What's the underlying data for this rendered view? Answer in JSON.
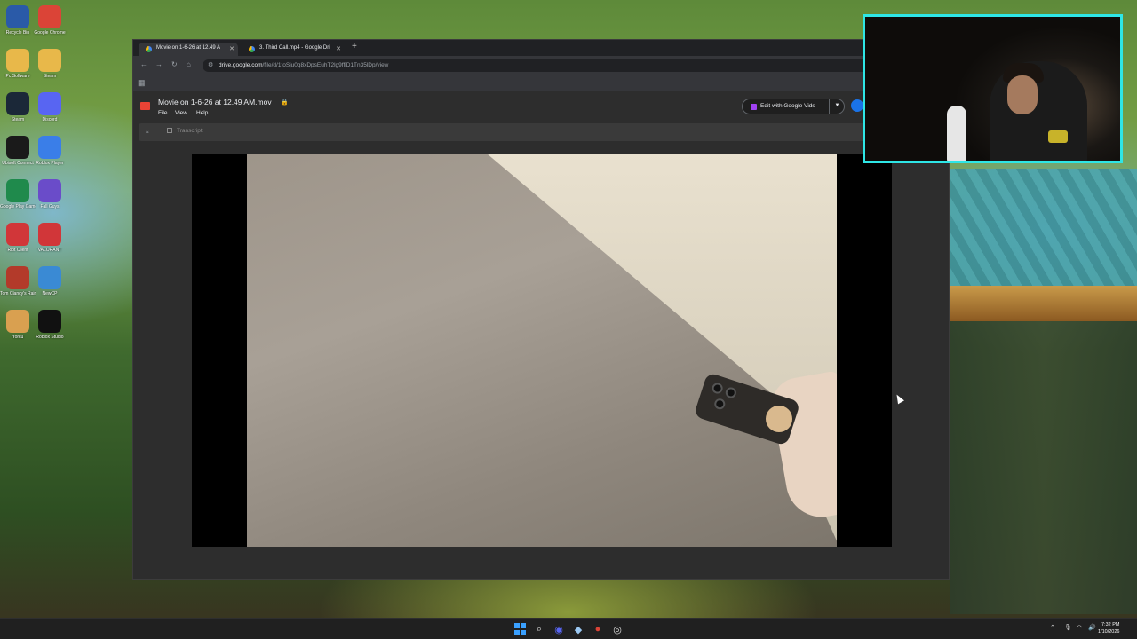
{
  "desktop": {
    "icons": [
      {
        "label": "Recycle Bin",
        "icon": "recycle-bin-icon",
        "color": "#2a5aa8"
      },
      {
        "label": "Google Chrome",
        "icon": "chrome-icon",
        "color": "#db4437"
      },
      {
        "label": "Pc Software",
        "icon": "folder-icon",
        "color": "#e8b84a"
      },
      {
        "label": "Steam",
        "icon": "folder-icon",
        "color": "#e8b84a"
      },
      {
        "label": "Steam",
        "icon": "steam-icon",
        "color": "#1b2838"
      },
      {
        "label": "Discord",
        "icon": "discord-icon",
        "color": "#5865f2"
      },
      {
        "label": "Ubisoft Connect",
        "icon": "ubisoft-icon",
        "color": "#1a1a1a"
      },
      {
        "label": "Roblox Player",
        "icon": "roblox-player-icon",
        "color": "#3a7ee8"
      },
      {
        "label": "Google Play Games",
        "icon": "google-play-games-icon",
        "color": "#1f8a4c"
      },
      {
        "label": "Fall Guys",
        "icon": "fall-guys-icon",
        "color": "#6a4cc9"
      },
      {
        "label": "Riot Client",
        "icon": "riot-client-icon",
        "color": "#d13639"
      },
      {
        "label": "VALORANT",
        "icon": "valorant-icon",
        "color": "#d13639"
      },
      {
        "label": "Tom Clancy's Rainbow Six",
        "icon": "rainbow-six-icon",
        "color": "#b33a2a"
      },
      {
        "label": "NewCP",
        "icon": "newcp-icon",
        "color": "#3a8ad4"
      },
      {
        "label": "Yorku",
        "icon": "yorku-icon",
        "color": "#d9a050"
      },
      {
        "label": "Roblox Studio",
        "icon": "roblox-studio-icon",
        "color": "#111111"
      }
    ]
  },
  "browser": {
    "tabs": [
      {
        "title": "Movie on 1-6-26 at 12.49 A",
        "active": true
      },
      {
        "title": "3. Third Call.mp4 - Google Dri",
        "active": false
      }
    ],
    "new_tab_label": "+",
    "url_host": "drive.google.com",
    "url_path": "/file/d/1toSju0q8xDpsEuhT2lg9ffiD1Tn35lDp/view"
  },
  "drive": {
    "file_title": "Movie on 1-6-26 at 12.49 AM.mov",
    "menu": [
      "File",
      "View",
      "Help"
    ],
    "edit_button_label": "Edit with Google Vids",
    "transcript_label": "Transcript"
  },
  "taskbar": {
    "time": "7:32 PM",
    "date": "1/10/2026"
  },
  "colors": {
    "webcam_border": "#2ee6e6",
    "drive_bg": "#2d2d2d",
    "taskbar_bg": "#202020"
  }
}
